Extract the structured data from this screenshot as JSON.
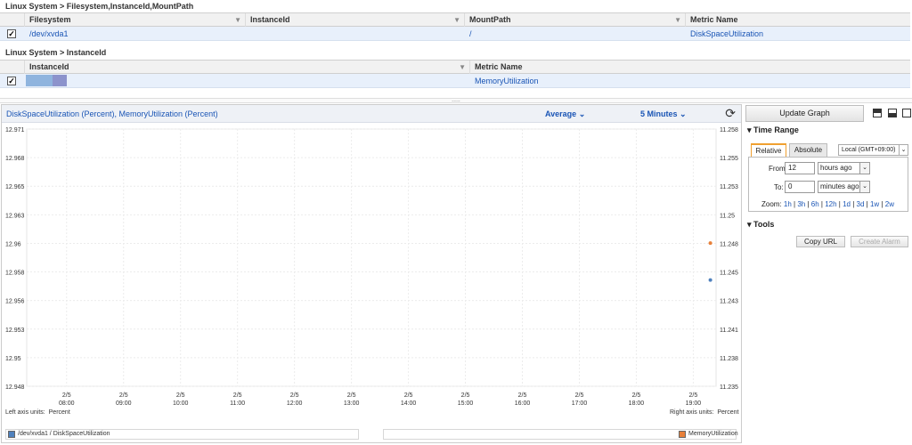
{
  "metrics_table_1": {
    "title": "Linux System > Filesystem,InstanceId,MountPath",
    "columns": [
      "Filesystem",
      "InstanceId",
      "MountPath",
      "Metric Name"
    ],
    "row": {
      "checked": true,
      "filesystem": "/dev/xvda1",
      "instance_id": "",
      "mount_path": "/",
      "metric_name": "DiskSpaceUtilization"
    }
  },
  "metrics_table_2": {
    "title": "Linux System > InstanceId",
    "columns": [
      "InstanceId",
      "Metric Name"
    ],
    "row": {
      "checked": true,
      "instance_id": "",
      "metric_name": "MemoryUtilization"
    }
  },
  "splitter_grip": ".....",
  "graph": {
    "title": "DiskSpaceUtilization (Percent), MemoryUtilization (Percent)",
    "statistic": "Average",
    "period": "5 Minutes",
    "left_axis_units_label": "Left axis units:",
    "left_axis_units": "Percent",
    "right_axis_units_label": "Right axis units:",
    "right_axis_units": "Percent",
    "legend": [
      {
        "label": "/dev/xvda1 / DiskSpaceUtilization",
        "color": "#4f81bd"
      },
      {
        "label": "MemoryUtilization",
        "color": "#e8803a"
      }
    ]
  },
  "chart_data": {
    "type": "scatter",
    "x_date_labels": [
      "2/5",
      "2/5",
      "2/5",
      "2/5",
      "2/5",
      "2/5",
      "2/5",
      "2/5",
      "2/5",
      "2/5",
      "2/5",
      "2/5"
    ],
    "x_time_labels": [
      "08:00",
      "09:00",
      "10:00",
      "11:00",
      "12:00",
      "13:00",
      "14:00",
      "15:00",
      "16:00",
      "17:00",
      "18:00",
      "19:00"
    ],
    "left_y_ticks": [
      "12.971",
      "12.968",
      "12.965",
      "12.963",
      "12.96",
      "12.958",
      "12.956",
      "12.953",
      "12.95",
      "12.948"
    ],
    "right_y_ticks": [
      "11.258",
      "11.255",
      "11.253",
      "11.25",
      "11.248",
      "11.245",
      "11.243",
      "11.241",
      "11.238",
      "11.235"
    ],
    "ylim_left": [
      12.948,
      12.971
    ],
    "ylim_right": [
      11.235,
      11.258
    ],
    "xlim_hours": [
      7.3,
      19.4
    ],
    "grid": true,
    "series": [
      {
        "name": "/dev/xvda1 / DiskSpaceUtilization",
        "axis": "left",
        "color": "#4f81bd",
        "points": [
          [
            19.3,
            12.9575
          ]
        ]
      },
      {
        "name": "MemoryUtilization",
        "axis": "right",
        "color": "#e8803a",
        "points": [
          [
            19.3,
            11.2478
          ]
        ]
      }
    ]
  },
  "side": {
    "update_button": "Update Graph",
    "time_range_heading": "Time Range",
    "tab_relative": "Relative",
    "tab_absolute": "Absolute",
    "timezone": "Local (GMT+09:00)",
    "from_label": "From:",
    "from_value": "12",
    "from_unit": "hours ago",
    "to_label": "To:",
    "to_value": "0",
    "to_unit": "minutes ago",
    "zoom_label": "Zoom:",
    "zoom_options": [
      "1h",
      "3h",
      "6h",
      "12h",
      "1d",
      "3d",
      "1w",
      "2w"
    ],
    "tools_heading": "Tools",
    "copy_url": "Copy URL",
    "create_alarm": "Create Alarm"
  }
}
